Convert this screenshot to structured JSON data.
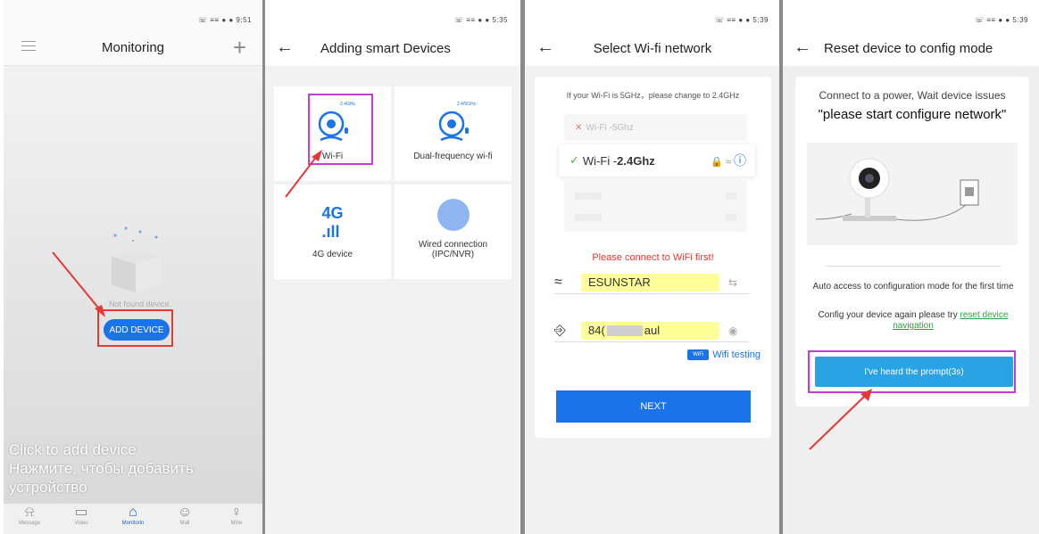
{
  "panel1": {
    "status": "☏ ≡≡ ● ● 9:51",
    "title": "Monitoring",
    "empty_text": "Not found device.",
    "add_button": "ADD DEVICE",
    "overlay_en": "Click to add device",
    "overlay_ru": "Нажмите, чтобы добавить устройство",
    "tabs": [
      {
        "label": "Message",
        "icon": "bell-icon",
        "glyph": "⍾"
      },
      {
        "label": "Video",
        "icon": "folder-icon",
        "glyph": "▭"
      },
      {
        "label": "Monitorin",
        "icon": "home-icon",
        "glyph": "⌂"
      },
      {
        "label": "Mall",
        "icon": "shop-icon",
        "glyph": "☺"
      },
      {
        "label": "Mine",
        "icon": "user-icon",
        "glyph": "♀"
      }
    ]
  },
  "panel2": {
    "status": "☏ ≡≡ ● ● 5:35",
    "title": "Adding smart Devices",
    "devices": [
      {
        "label": "Wi-Fi",
        "badge": "2.4GHz"
      },
      {
        "label": "Dual-frequency wi-fi",
        "badge": "2.4/5GHz"
      },
      {
        "label": "4G device",
        "badge": "4G"
      },
      {
        "label": "Wired connection\n(IPC/NVR)",
        "badge": ""
      }
    ]
  },
  "panel3": {
    "status": "☏ ≡≡ ● ● 5:39",
    "title": "Select Wi-fi network",
    "hint": "If your Wi-Fi is 5GHz，please change to 2.4GHz",
    "wifi_5g_prefix": "Wi-Fi - ",
    "wifi_5g": "5Ghz",
    "wifi_24g_prefix": "Wi-Fi - ",
    "wifi_24g": "2.4Ghz",
    "error": "Please connect to WiFi first!",
    "ssid": "ESUNSTAR",
    "password_start": "84(",
    "password_end": "aul",
    "wifi_testing": "Wifi testing",
    "wt_badge": "WiFi",
    "next": "NEXT"
  },
  "panel4": {
    "status": "☏ ≡≡ ● ● 5:39",
    "title": "Reset device to config mode",
    "line1": "Connect to a power, Wait device issues",
    "line2": "\"please start configure network\"",
    "auto_text": "Auto access to configuration mode for the first time",
    "again_text": "Config your device again please try ",
    "again_link": "reset device navigation",
    "button": "I've heard the prompt(3s)"
  },
  "colors": {
    "primary_blue": "#1a73e8",
    "highlight_red": "#e53935",
    "highlight_purple": "#c43bd8",
    "prompt_button": "#29a3e3",
    "link_green": "#2e9e44"
  }
}
